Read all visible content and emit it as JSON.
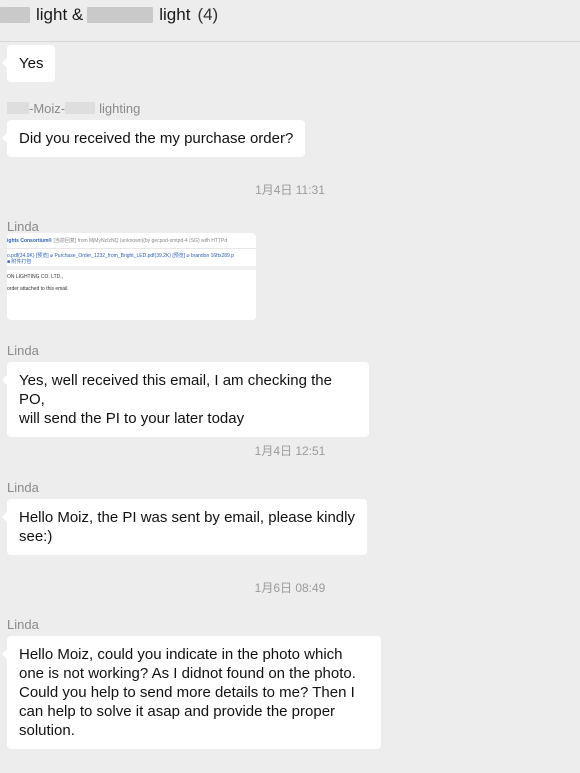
{
  "header": {
    "title_part1": "light &",
    "title_part2": "light",
    "count": "(4)"
  },
  "messages": {
    "m1_text": "Yes",
    "sender2_a": "-Moiz-",
    "sender2_b": "lighting",
    "m2_text": "Did you received the my purchase order?",
    "time1": "1月4日 11:31",
    "sender3": "Linda",
    "img": {
      "row1_bold": "ights Consortium®",
      "row1_rest": "[当前回复]  from MjMyNzIzNQ (unknown)(by gecpod-smtpd-4 (SG) with HTTPd",
      "row2": "o.pdf(34.9K) [预览]  ⌀ Purchase_Order_1232_from_Bright_LED.pdf(39.2K) [预览]  ⌀ brandon 16ftx289.p",
      "row3": "■ 附件打包",
      "row4": "ON LIGHTING CO. LTD.,",
      "row5": "order attached to this email."
    },
    "sender4": "Linda",
    "m4_line1": "Yes, well received this email, I am checking the PO,",
    "m4_line2": "will send the PI to your later today",
    "time2": "1月4日 12:51",
    "sender5": "Linda",
    "m5_line1": "Hello Moiz, the PI was sent by email, please kindly",
    "m5_line2": "see:)",
    "time3": "1月6日 08:49",
    "sender6": "Linda",
    "m6_line1": "Hello Moiz, could you indicate in the photo which",
    "m6_line2": "one is not working? As I didnot found on the photo.",
    "m6_line3": "Could you help to send more details to me? Then I",
    "m6_line4": "can help to solve it asap and provide the proper",
    "m6_line5": "solution."
  }
}
